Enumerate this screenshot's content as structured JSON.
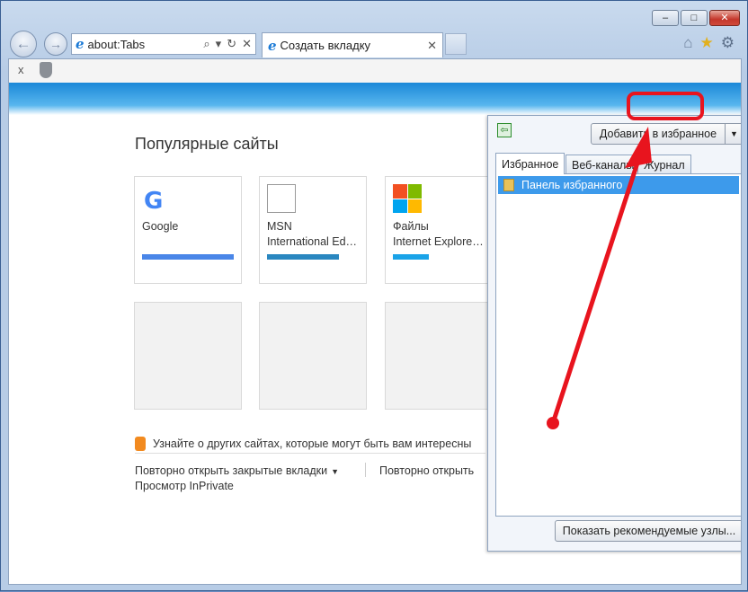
{
  "window": {
    "caption_buttons": [
      "–",
      "□",
      "✕"
    ]
  },
  "nav": {
    "back_icon": "back-arrow-icon",
    "forward_icon": "forward-arrow-icon",
    "address_text": "about:Tabs",
    "address_icons": [
      "⌕",
      "▾",
      "↻",
      "✕"
    ],
    "tab_title": "Создать вкладку",
    "tab_close": "✕",
    "right_icons": [
      "home-icon",
      "star-icon",
      "gear-icon"
    ]
  },
  "notification": {
    "close": "x"
  },
  "newtab": {
    "title": "Популярные сайты",
    "tiles": [
      {
        "label": "Google",
        "bar_color": "#4a86e8"
      },
      {
        "label": "MSN\nInternational Ed…",
        "bar_color": "#2a87c0"
      },
      {
        "label": "Файлы\nInternet Explore…",
        "bar_color": "#1aa3e8"
      }
    ],
    "learn_more": "Узнайте о других сайтах, которые могут быть вам интересны",
    "reopen_closed": "Повторно открыть закрытые вкладки",
    "reopen_last": "Повторно открыть",
    "inprivate": "Просмотр InPrivate"
  },
  "favorites_panel": {
    "add_button": "Добавить в избранное",
    "tabs": [
      "Избранное",
      "Веб-каналы",
      "Журнал"
    ],
    "active_tab": "Избранное",
    "items": [
      "Панель избранного"
    ],
    "show_recommended": "Показать рекомендуемые узлы..."
  },
  "annotation": {
    "highlight_color": "#e8141e"
  }
}
